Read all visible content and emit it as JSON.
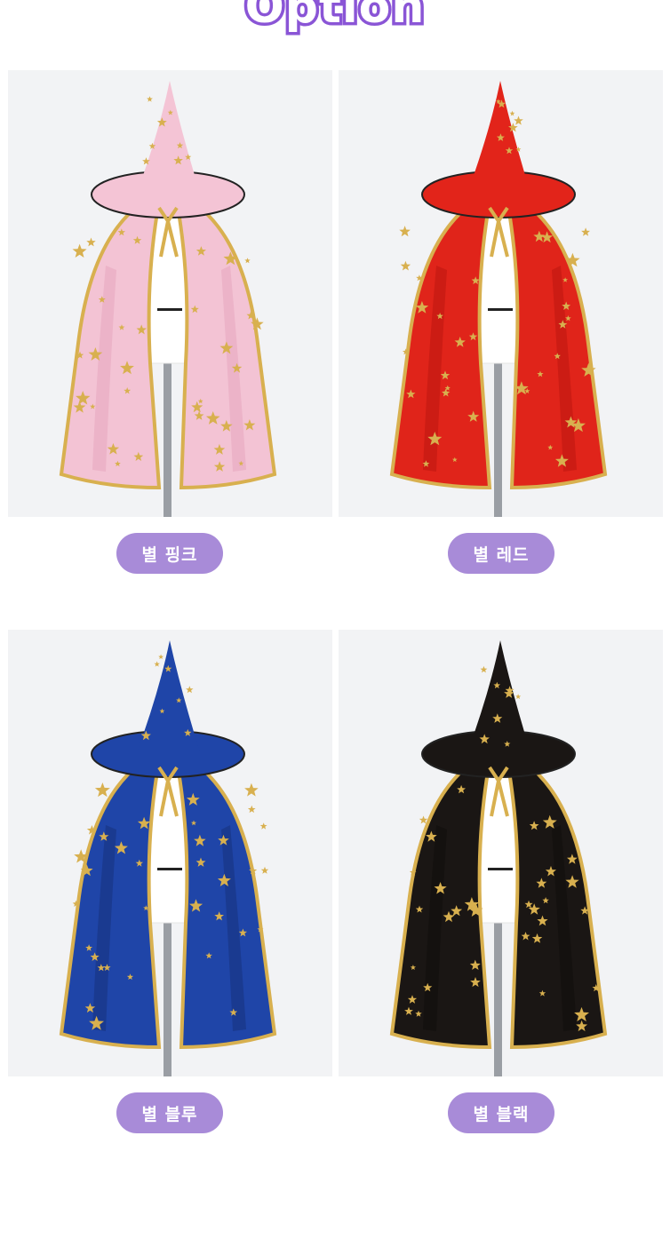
{
  "title": "Option",
  "options": [
    {
      "label": "별 핑크",
      "cape_color": "#f3c3d4",
      "cape_shade": "#e6a4bc",
      "hat_color": "#f4c4d5"
    },
    {
      "label": "별 레드",
      "cape_color": "#e0241a",
      "cape_shade": "#b7140d",
      "hat_color": "#e2241a"
    },
    {
      "label": "별 블루",
      "cape_color": "#1f45a8",
      "cape_shade": "#162f78",
      "hat_color": "#1f45a8"
    },
    {
      "label": "별 블랙",
      "cape_color": "#1a1614",
      "cape_shade": "#0d0b0a",
      "hat_color": "#1a1614"
    }
  ],
  "colors": {
    "accent": "#a88bd8",
    "title_stroke": "#8a55d6",
    "gold": "#d8b04f"
  }
}
